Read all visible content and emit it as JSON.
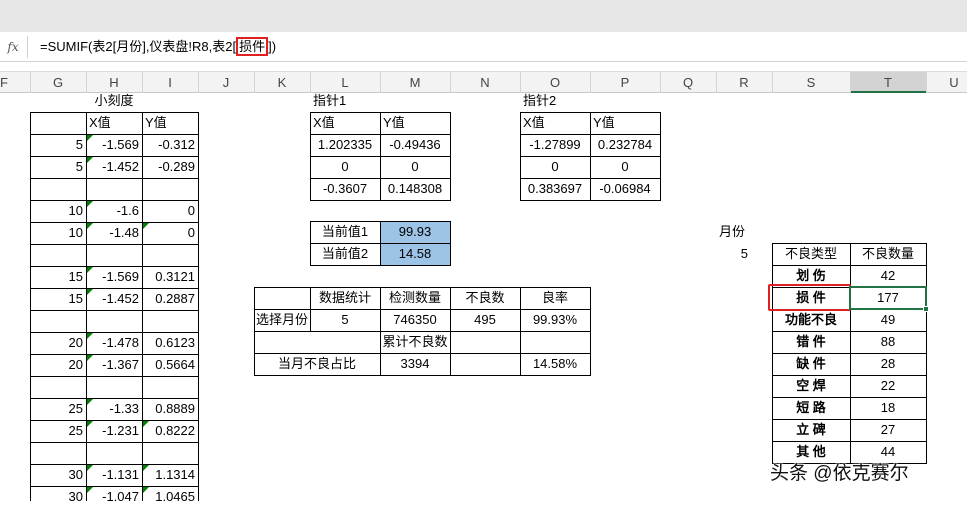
{
  "formula_bar": {
    "fx_label": "fx",
    "formula_prefix": "=SUMIF(表2[月份],仪表盘!R8,表2[",
    "formula_boxed": "损件",
    "formula_suffix": "])"
  },
  "columns": [
    "F",
    "G",
    "H",
    "I",
    "J",
    "K",
    "L",
    "M",
    "N",
    "O",
    "P",
    "Q",
    "R",
    "S",
    "T",
    "U"
  ],
  "small_scale": {
    "title": "小刻度",
    "header_x": "X值",
    "header_y": "Y值",
    "rows": [
      [
        "5",
        "-1.569",
        "-0.312"
      ],
      [
        "5",
        "-1.452",
        "-0.289"
      ],
      [
        "",
        "",
        ""
      ],
      [
        "10",
        "-1.6",
        "0"
      ],
      [
        "10",
        "-1.48",
        "0"
      ],
      [
        "",
        "",
        ""
      ],
      [
        "15",
        "-1.569",
        "0.3121"
      ],
      [
        "15",
        "-1.452",
        "0.2887"
      ],
      [
        "",
        "",
        ""
      ],
      [
        "20",
        "-1.478",
        "0.6123"
      ],
      [
        "20",
        "-1.367",
        "0.5664"
      ],
      [
        "",
        "",
        ""
      ],
      [
        "25",
        "-1.33",
        "0.8889"
      ],
      [
        "25",
        "-1.231",
        "0.8222"
      ],
      [
        "",
        "",
        ""
      ],
      [
        "30",
        "-1.131",
        "1.1314"
      ],
      [
        "30",
        "-1.047",
        "1.0465"
      ]
    ]
  },
  "pointer1": {
    "title": "指针1",
    "header_x": "X值",
    "header_y": "Y值",
    "rows": [
      [
        "1.202335",
        "-0.49436"
      ],
      [
        "0",
        "0"
      ],
      [
        "-0.3607",
        "0.148308"
      ]
    ]
  },
  "pointer2": {
    "title": "指针2",
    "header_x": "X值",
    "header_y": "Y值",
    "rows": [
      [
        "-1.27899",
        "0.232784"
      ],
      [
        "0",
        "0"
      ],
      [
        "0.383697",
        "-0.06984"
      ]
    ]
  },
  "current": {
    "label1": "当前值1",
    "value1": "99.93",
    "label2": "当前值2",
    "value2": "14.58"
  },
  "stats": {
    "h_stats": "数据统计",
    "h_inspect": "检测数量",
    "h_defect": "不良数",
    "h_rate": "良率",
    "select_label": "选择月份",
    "month": "5",
    "inspect": "746350",
    "defect": "495",
    "rate": "99.93%",
    "cum_label": "累计不良数",
    "ratio_label": "当月不良占比",
    "cum_value": "3394",
    "ratio": "14.58%"
  },
  "month": {
    "label": "月份",
    "value": "5"
  },
  "defects": {
    "h_type": "不良类型",
    "h_count": "不良数量",
    "rows": [
      [
        "划 伤",
        "42"
      ],
      [
        "损 件",
        "177"
      ],
      [
        "功能不良",
        "49"
      ],
      [
        "错 件",
        "88"
      ],
      [
        "缺 件",
        "28"
      ],
      [
        "空 焊",
        "22"
      ],
      [
        "短 路",
        "18"
      ],
      [
        "立 碑",
        "27"
      ],
      [
        "其 他",
        "44"
      ]
    ]
  },
  "watermark": "头条 @依克赛尔",
  "colors": {
    "highlight": "#9dc3e6",
    "red_box": "#e02020",
    "select_green": "#217346"
  }
}
